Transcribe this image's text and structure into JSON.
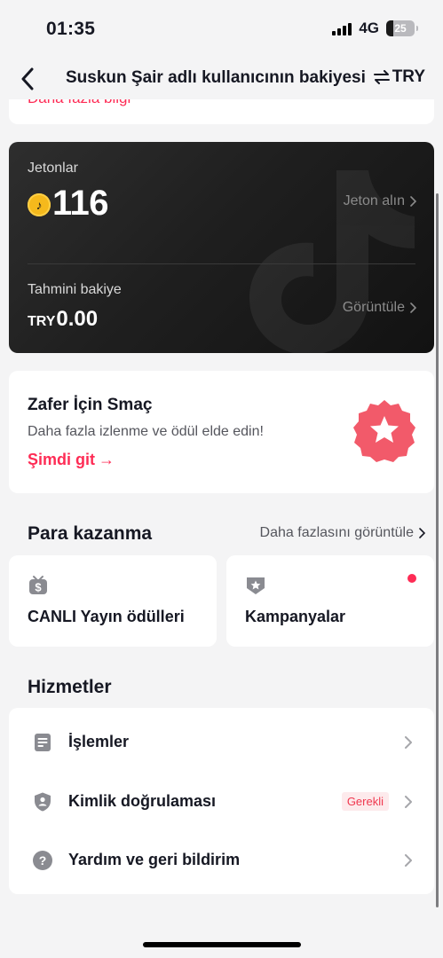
{
  "status_bar": {
    "time": "01:35",
    "network": "4G",
    "battery": "25",
    "battery_level": 0.25
  },
  "header": {
    "title": "Suskun Şair adlı kullanıcının bakiyesi",
    "currency": "TRY",
    "back_icon": "chevron-left-icon",
    "switch_icon": "swap-arrows-icon"
  },
  "top_card": {
    "link_text": "Daha fazla bilgi"
  },
  "balance": {
    "coins_label": "Jetonlar",
    "coins_value": "116",
    "get_coins_label": "Jeton alın",
    "estimated_label": "Tahmini bakiye",
    "estimated_currency": "TRY",
    "estimated_value": "0.00",
    "view_label": "Görüntüle",
    "coin_icon": "tiktok-coin-icon"
  },
  "promo": {
    "title": "Zafer İçin Smaç",
    "subtitle": "Daha fazla izlenme ve ödül elde edin!",
    "cta": "Şimdi git",
    "cta_arrow": "→",
    "badge_icon": "star-badge-icon",
    "badge_color": "#f25a6a"
  },
  "earn": {
    "title": "Para kazanma",
    "more_label": "Daha fazlasını görüntüle",
    "tiles": [
      {
        "label": "CANLI Yayın ödülleri",
        "icon": "live-money-icon"
      },
      {
        "label": "Kampanyalar",
        "icon": "campaign-badge-icon",
        "has_dot": true
      }
    ]
  },
  "services": {
    "title": "Hizmetler",
    "items": [
      {
        "label": "İşlemler",
        "icon": "document-icon"
      },
      {
        "label": "Kimlik doğrulaması",
        "icon": "shield-user-icon",
        "badge": "Gerekli"
      },
      {
        "label": "Yardım ve geri bildirim",
        "icon": "help-icon"
      }
    ]
  },
  "colors": {
    "accent": "#fe2c55",
    "background": "#f4f4f5",
    "card_dark": "#1f1f1f"
  }
}
